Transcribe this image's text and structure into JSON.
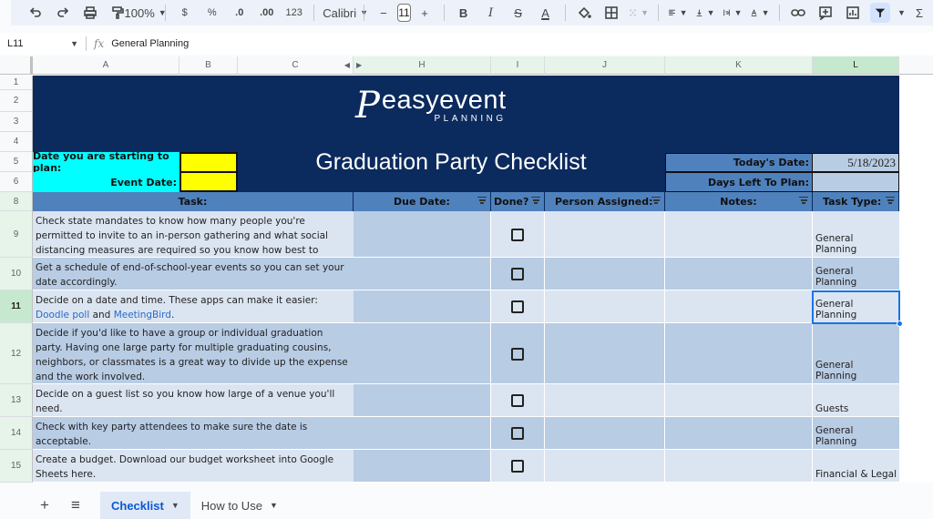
{
  "toolbar": {
    "zoom": "100%",
    "currency": "$",
    "percent": "%",
    "decrease_decimal": ".0",
    "increase_decimal": ".00",
    "number_format": "123",
    "font": "Calibri",
    "font_size": "11",
    "bold": "B",
    "italic": "I",
    "text_color": "A",
    "icons": [
      "undo-icon",
      "redo-icon",
      "print-icon",
      "paint-format-icon",
      "fill-color-icon",
      "borders-icon",
      "merge-cells-icon",
      "align-icon",
      "valign-icon",
      "wrap-icon",
      "rotate-icon",
      "link-icon",
      "comment-icon",
      "chart-icon",
      "filter-icon",
      "functions-icon"
    ]
  },
  "formula_bar": {
    "cell_ref": "L11",
    "fx": "fx",
    "content": "General Planning"
  },
  "columns": [
    "A",
    "B",
    "C",
    "H",
    "I",
    "J",
    "K",
    "L"
  ],
  "rows": [
    "1",
    "2",
    "3",
    "4",
    "5",
    "6",
    "8",
    "9",
    "10",
    "11",
    "12",
    "13",
    "14",
    "15"
  ],
  "selected_cell": "L11",
  "header": {
    "logo_mark": "P",
    "logo_text": "easyevent",
    "logo_sub": "PLANNING",
    "title": "Graduation Party Checklist",
    "start_label": "Date you are starting to plan:",
    "start_value": "",
    "event_label": "Event Date:",
    "event_value": "",
    "today_label": "Today's Date:",
    "today_value": "5/18/2023",
    "days_left_label": "Days Left To Plan:",
    "days_left_value": ""
  },
  "table": {
    "headers": {
      "task": "Task:",
      "due": "Due Date:",
      "done": "Done?",
      "person": "Person Assigned:",
      "notes": "Notes:",
      "type": "Task Type:"
    },
    "rows": [
      {
        "row": "9",
        "task": "Check state mandates to know how many people you're permitted to invite to an in-person gathering and what social distancing measures are required so you know how best to proceed.",
        "done": false,
        "type": "General Planning"
      },
      {
        "row": "10",
        "task": "Get a schedule of end-of-school-year events so you can set your date accordingly.",
        "done": false,
        "type": "General Planning"
      },
      {
        "row": "11",
        "task_pre": "Decide on a date and time. These apps can make it easier: ",
        "link1": "Doodle poll",
        "task_mid": " and ",
        "link2": "MeetingBird",
        "task_post": ".",
        "done": false,
        "type": "General Planning"
      },
      {
        "row": "12",
        "task": "Decide if you'd like to have a group or individual graduation party. Having one large party for multiple graduating cousins, neighbors, or classmates is a great way to divide up the expense and the work involved.",
        "done": false,
        "type": "General Planning"
      },
      {
        "row": "13",
        "task": "Decide on a guest list so you know how large of a venue you'll need.",
        "done": false,
        "type": "Guests"
      },
      {
        "row": "14",
        "task": "Check with key party attendees to make sure the date is acceptable.",
        "done": false,
        "type": "General Planning"
      },
      {
        "row": "15",
        "task": "Create a budget. Download our budget worksheet into Google Sheets here.",
        "done": false,
        "type": "Financial & Legal"
      }
    ]
  },
  "sheet_tabs": {
    "add": "+",
    "menu": "≡",
    "tabs": [
      {
        "label": "Checklist",
        "active": true
      },
      {
        "label": "How to Use",
        "active": false
      }
    ]
  }
}
